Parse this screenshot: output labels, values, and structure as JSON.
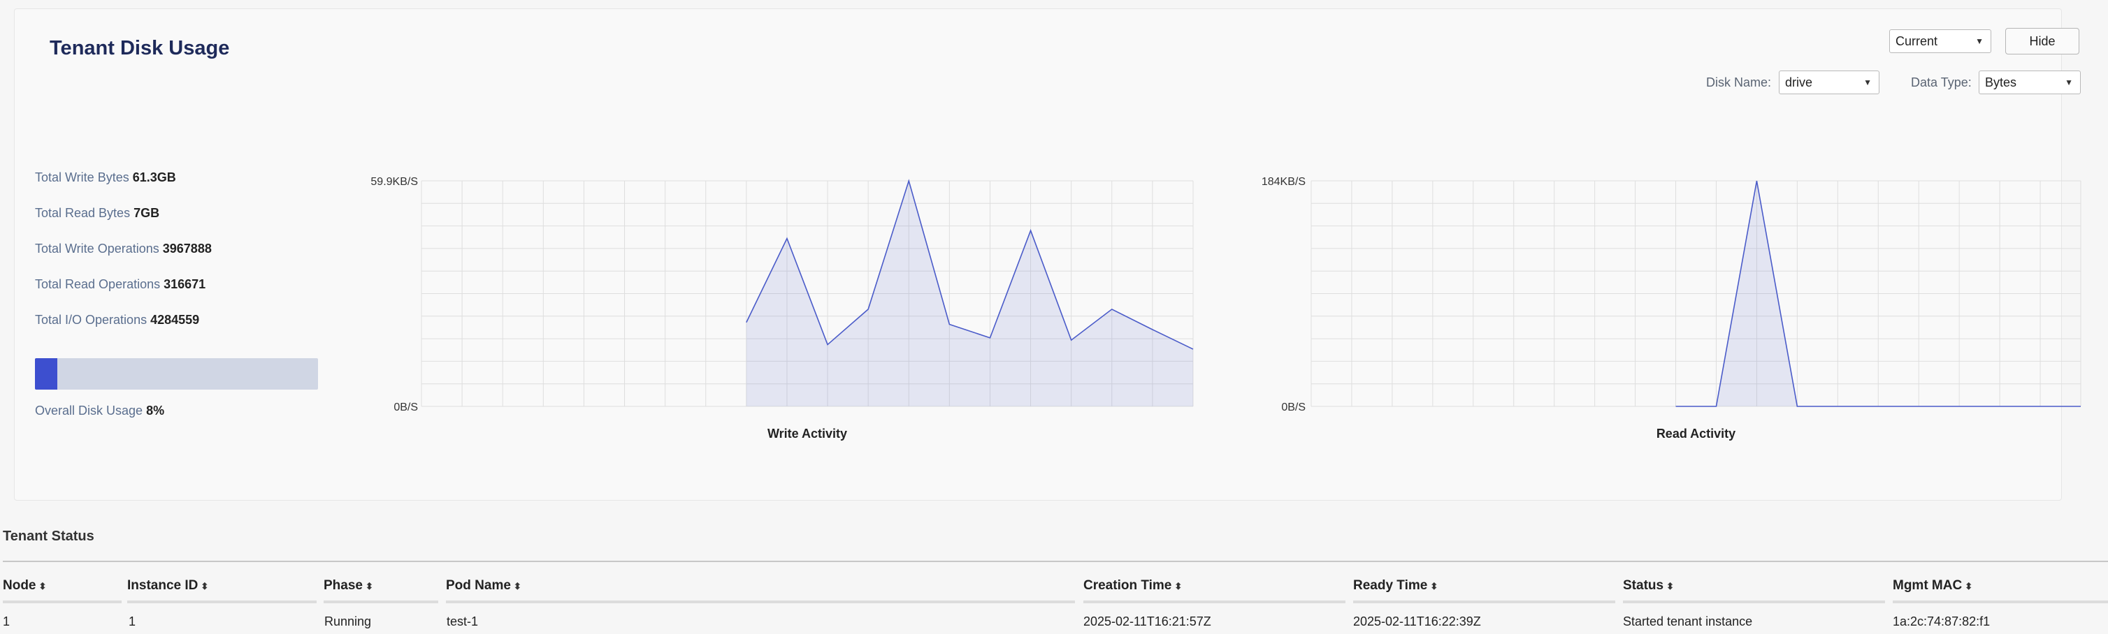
{
  "panel": {
    "title": "Tenant Disk Usage",
    "time_select": "Current",
    "hide_label": "Hide",
    "disk_name_label": "Disk Name:",
    "disk_name_value": "drive",
    "data_type_label": "Data Type:",
    "data_type_value": "Bytes"
  },
  "stats": [
    {
      "label": "Total Write Bytes",
      "value": "61.3GB"
    },
    {
      "label": "Total Read Bytes",
      "value": "7GB"
    },
    {
      "label": "Total Write Operations",
      "value": "3967888"
    },
    {
      "label": "Total Read Operations",
      "value": "316671"
    },
    {
      "label": "Total I/O Operations",
      "value": "4284559"
    }
  ],
  "usage": {
    "label": "Overall Disk Usage",
    "value": "8%",
    "fraction": 0.08
  },
  "chart_data": [
    {
      "type": "area",
      "title": "Write Activity",
      "y_max_label": "59.9KB/S",
      "y_min_label": "0B/S",
      "ylim": [
        0,
        59.9
      ],
      "y_unit": "KB/S",
      "slots": 20,
      "values": [
        null,
        null,
        null,
        null,
        null,
        null,
        null,
        null,
        22.3,
        44.6,
        16.4,
        25.8,
        59.9,
        21.8,
        18.2,
        46.7,
        17.6,
        25.8,
        20.4,
        15.2
      ],
      "grid": true,
      "color": "#4a5bc9"
    },
    {
      "type": "area",
      "title": "Read Activity",
      "y_max_label": "184KB/S",
      "y_min_label": "0B/S",
      "ylim": [
        0,
        184
      ],
      "y_unit": "KB/S",
      "slots": 20,
      "values": [
        null,
        null,
        null,
        null,
        null,
        null,
        null,
        null,
        null,
        0,
        0,
        184,
        0,
        0,
        0,
        0,
        0,
        0,
        0,
        0,
        0
      ],
      "grid": true,
      "color": "#4a5bc9"
    }
  ],
  "tenant_status": {
    "title": "Tenant Status",
    "columns": [
      "Node",
      "Instance ID",
      "Phase",
      "Pod Name",
      "Creation Time",
      "Ready Time",
      "Status",
      "Mgmt MAC"
    ],
    "sort_icon": "sort-icon",
    "rows": [
      [
        "1",
        "1",
        "Running",
        "test-1",
        "2025-02-11T16:21:57Z",
        "2025-02-11T16:22:39Z",
        "Started tenant instance",
        "1a:2c:74:87:82:f1"
      ]
    ]
  }
}
